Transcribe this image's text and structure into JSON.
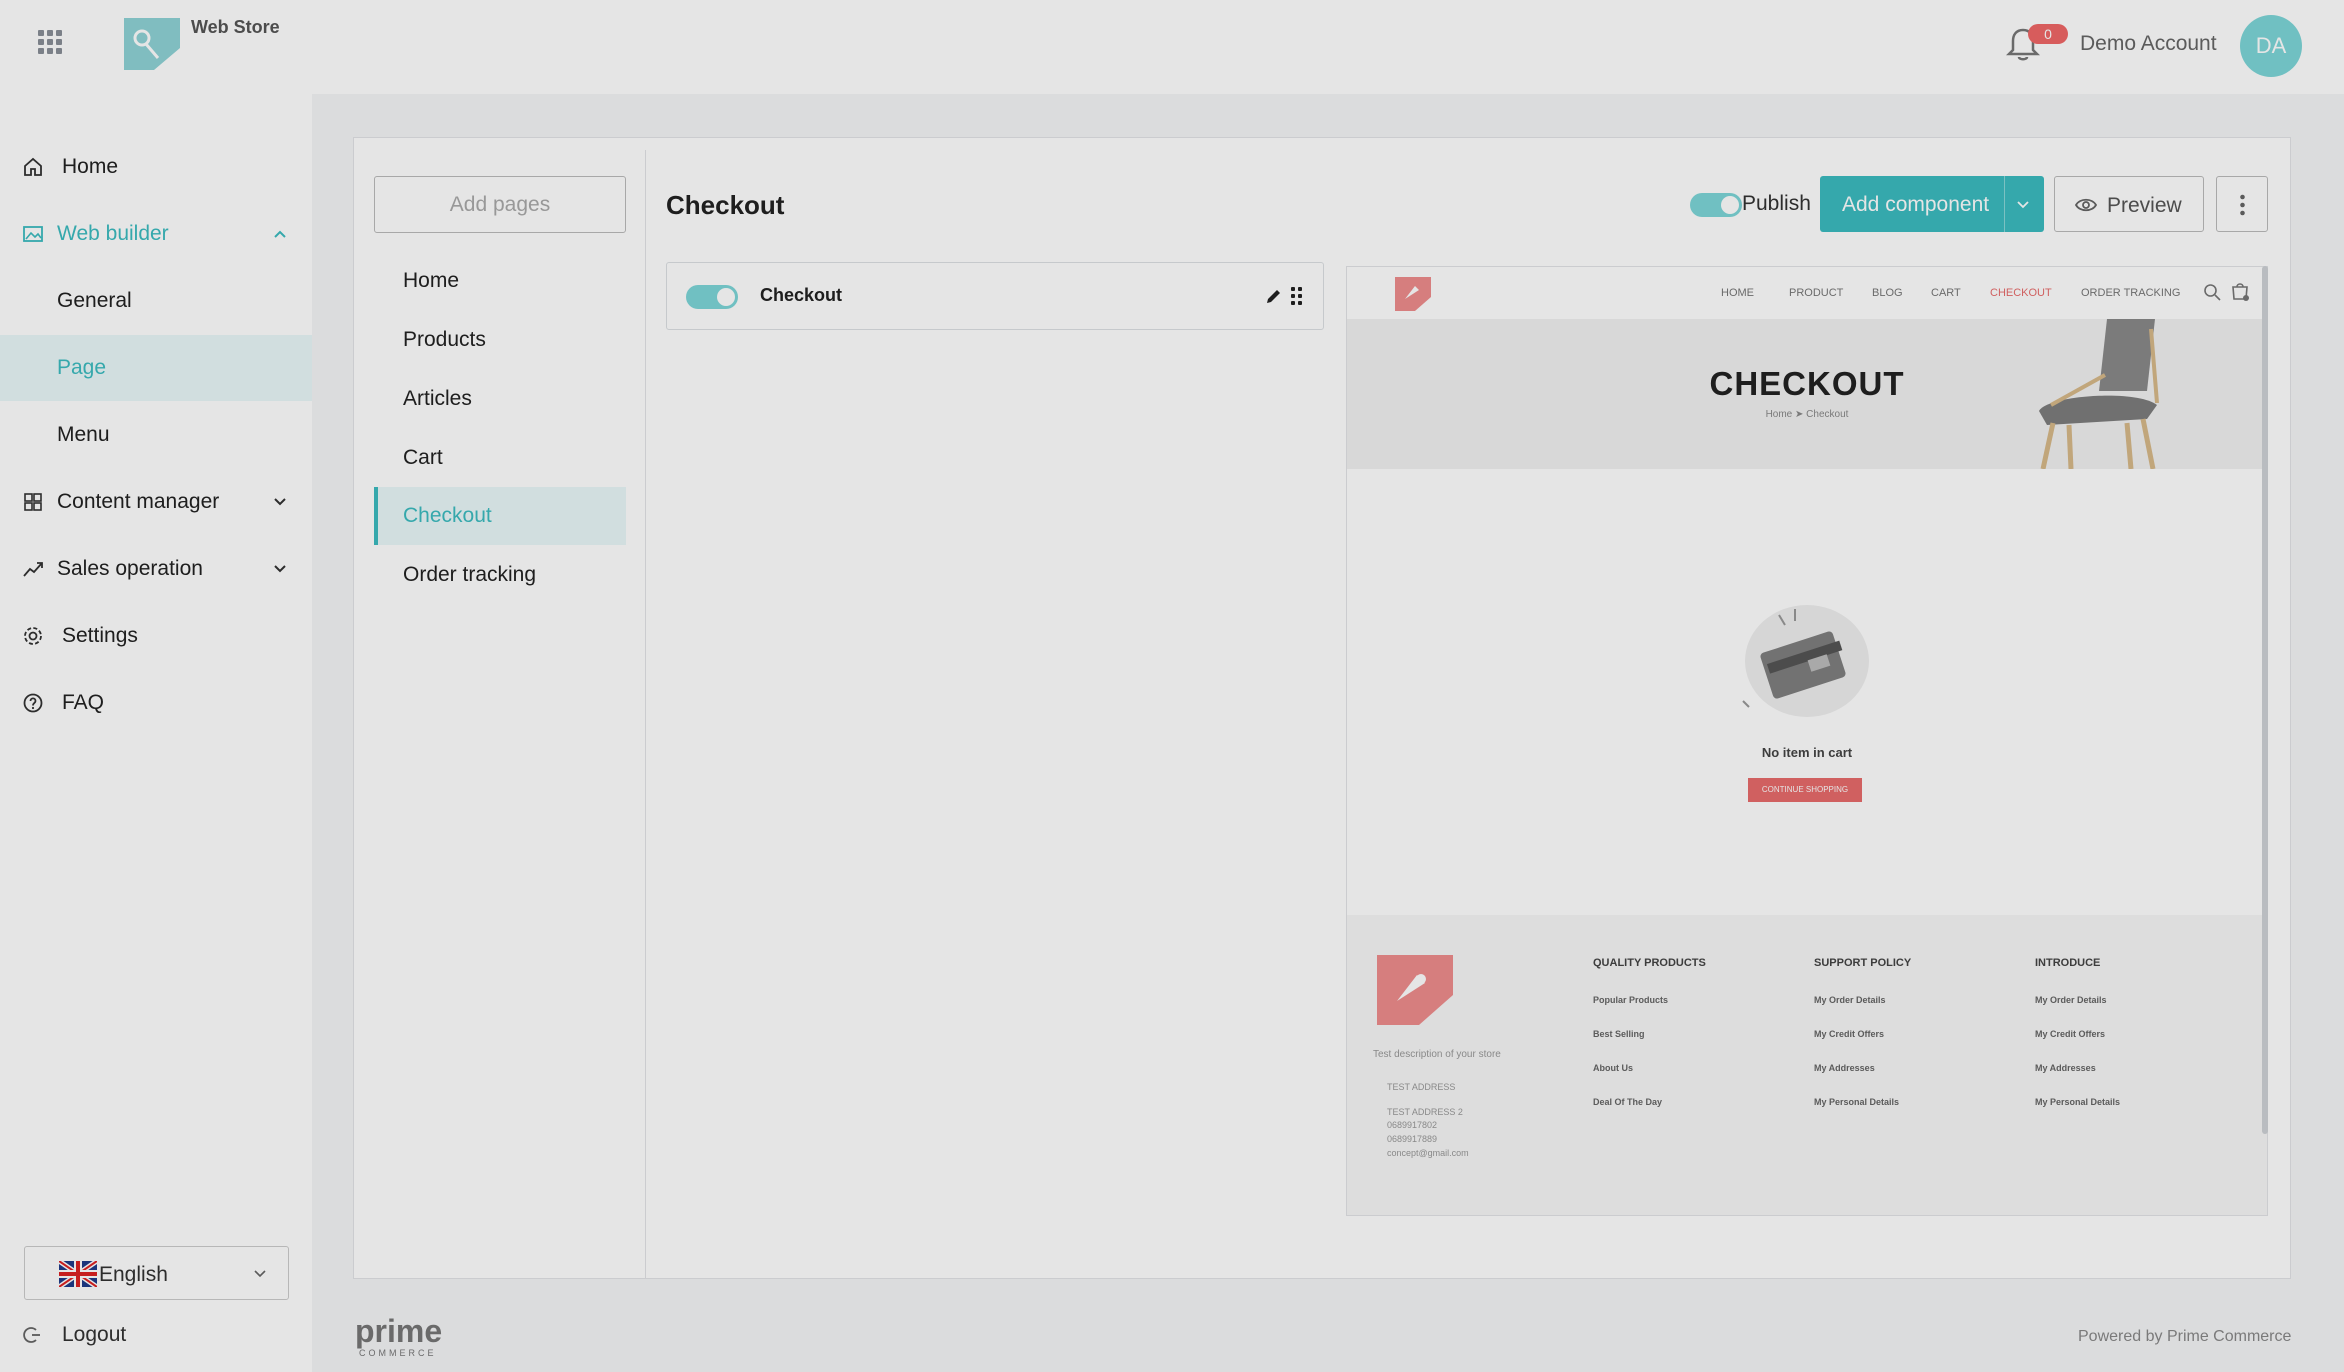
{
  "topbar": {
    "store_name": "Web Store",
    "notification_count": "0",
    "account_name": "Demo Account",
    "avatar_initials": "DA"
  },
  "sidebar": {
    "items": [
      {
        "label": "Home",
        "icon": "home-icon"
      },
      {
        "label": "Web builder",
        "icon": "image-icon",
        "expanded": true
      },
      {
        "label": "General"
      },
      {
        "label": "Page",
        "selected": true
      },
      {
        "label": "Menu"
      },
      {
        "label": "Content manager",
        "icon": "grid-icon"
      },
      {
        "label": "Sales operation",
        "icon": "trend-icon"
      },
      {
        "label": "Settings",
        "icon": "gear-icon"
      },
      {
        "label": "FAQ",
        "icon": "help-icon"
      }
    ],
    "language": "English",
    "logout_label": "Logout"
  },
  "pages_panel": {
    "add_pages_label": "Add pages",
    "pages": [
      "Home",
      "Products",
      "Articles",
      "Cart",
      "Checkout",
      "Order tracking"
    ],
    "selected": "Checkout"
  },
  "editor": {
    "title": "Checkout",
    "components": [
      {
        "label": "Checkout",
        "enabled": true
      }
    ]
  },
  "toolbar": {
    "publish_label": "Publish",
    "publish_enabled": true,
    "add_component_label": "Add component",
    "preview_label": "Preview"
  },
  "preview": {
    "nav": [
      "HOME",
      "PRODUCT",
      "BLOG",
      "CART",
      "CHECKOUT",
      "ORDER TRACKING"
    ],
    "nav_active": "CHECKOUT",
    "hero_title": "CHECKOUT",
    "breadcrumb": "Home ➤ Checkout",
    "empty_text": "No item in cart",
    "continue_label": "CONTINUE SHOPPING",
    "footer": {
      "description": "Test description of your store",
      "address_lines": [
        "TEST ADDRESS",
        "TEST ADDRESS 2",
        "0689917802",
        "0689917889",
        "concept@gmail.com"
      ],
      "columns": [
        {
          "title": "QUALITY PRODUCTS",
          "links": [
            "Popular Products",
            "Best Selling",
            "About Us",
            "Deal Of The Day"
          ]
        },
        {
          "title": "SUPPORT POLICY",
          "links": [
            "My Order Details",
            "My Credit Offers",
            "My Addresses",
            "My Personal Details"
          ]
        },
        {
          "title": "INTRODUCE",
          "links": [
            "My Order Details",
            "My Credit Offers",
            "My Addresses",
            "My Personal Details"
          ]
        }
      ]
    }
  },
  "footer": {
    "brand_text": "prime",
    "brand_sub": "COMMERCE",
    "powered_by": "Powered by Prime Commerce"
  },
  "colors": {
    "accent": "#3cbcc0",
    "accent_light": "#e9f8f9",
    "preview_accent": "#e86b6b"
  }
}
